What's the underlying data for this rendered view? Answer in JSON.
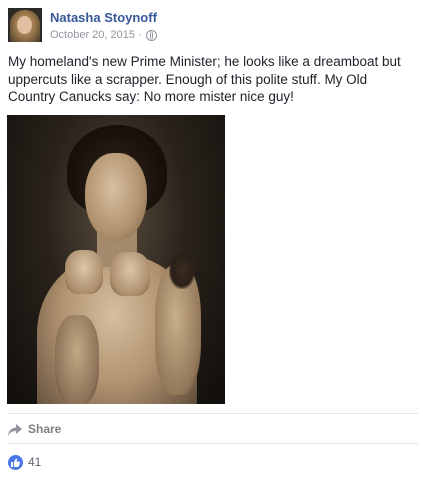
{
  "post": {
    "author": "Natasha Stoynoff",
    "date": "October 20, 2015",
    "separator": "·",
    "privacy_icon": "globe-icon",
    "text": "My homeland's new Prime Minister; he looks like a dreamboat but uppercuts like a scrapper. Enough of this polite stuff. My Old Country Canucks say: No more mister nice guy!",
    "photo_description_icon": "post-photo",
    "actions": {
      "share_label": "Share"
    },
    "reactions": {
      "like_count": "41"
    }
  },
  "colors": {
    "author_link": "#365899",
    "meta_text": "#90949c",
    "body_text": "#1d2129",
    "like_blue": "#4b76e6",
    "action_gray": "#7f7f7f"
  }
}
